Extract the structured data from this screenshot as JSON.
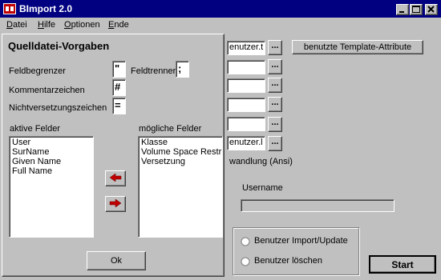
{
  "window": {
    "title": "BImport 2.0"
  },
  "menu": [
    {
      "label": "Datei"
    },
    {
      "label": "Hilfe"
    },
    {
      "label": "Optionen"
    },
    {
      "label": "Ende"
    }
  ],
  "main": {
    "fields": [
      "enutzer.t",
      "",
      "",
      "",
      "",
      "enutzer.l"
    ],
    "browse_label": "...",
    "template_button": "benutzte Template-Attribute",
    "conversion_text": "wandlung (Ansi)",
    "username_label": "Username",
    "username_progress": 0,
    "radio_import": "Benutzer Import/Update",
    "radio_delete": "Benutzer löschen",
    "start_button": "Start"
  },
  "dialog": {
    "title": "Quelldatei-Vorgaben",
    "feldbegrenzer_label": "Feldbegrenzer",
    "feldbegrenzer_value": "\"",
    "feldtrenner_label": "Feldtrenner",
    "feldtrenner_value": ";",
    "kommentar_label": "Kommentarzeichen",
    "kommentar_value": "#",
    "nichtversetzung_label": "Nichtversetzungszeichen",
    "nichtversetzung_value": "=",
    "aktive_label": "aktive Felder",
    "aktive_items": [
      "User",
      "SurName",
      "Given Name",
      "Full Name"
    ],
    "moegliche_label": "mögliche Felder",
    "moegliche_items": [
      "Klasse",
      "Volume Space Restri",
      "Versetzung"
    ],
    "ok_button": "Ok"
  },
  "colors": {
    "titlebar": "#000080",
    "arrow_red": "#c00000"
  }
}
